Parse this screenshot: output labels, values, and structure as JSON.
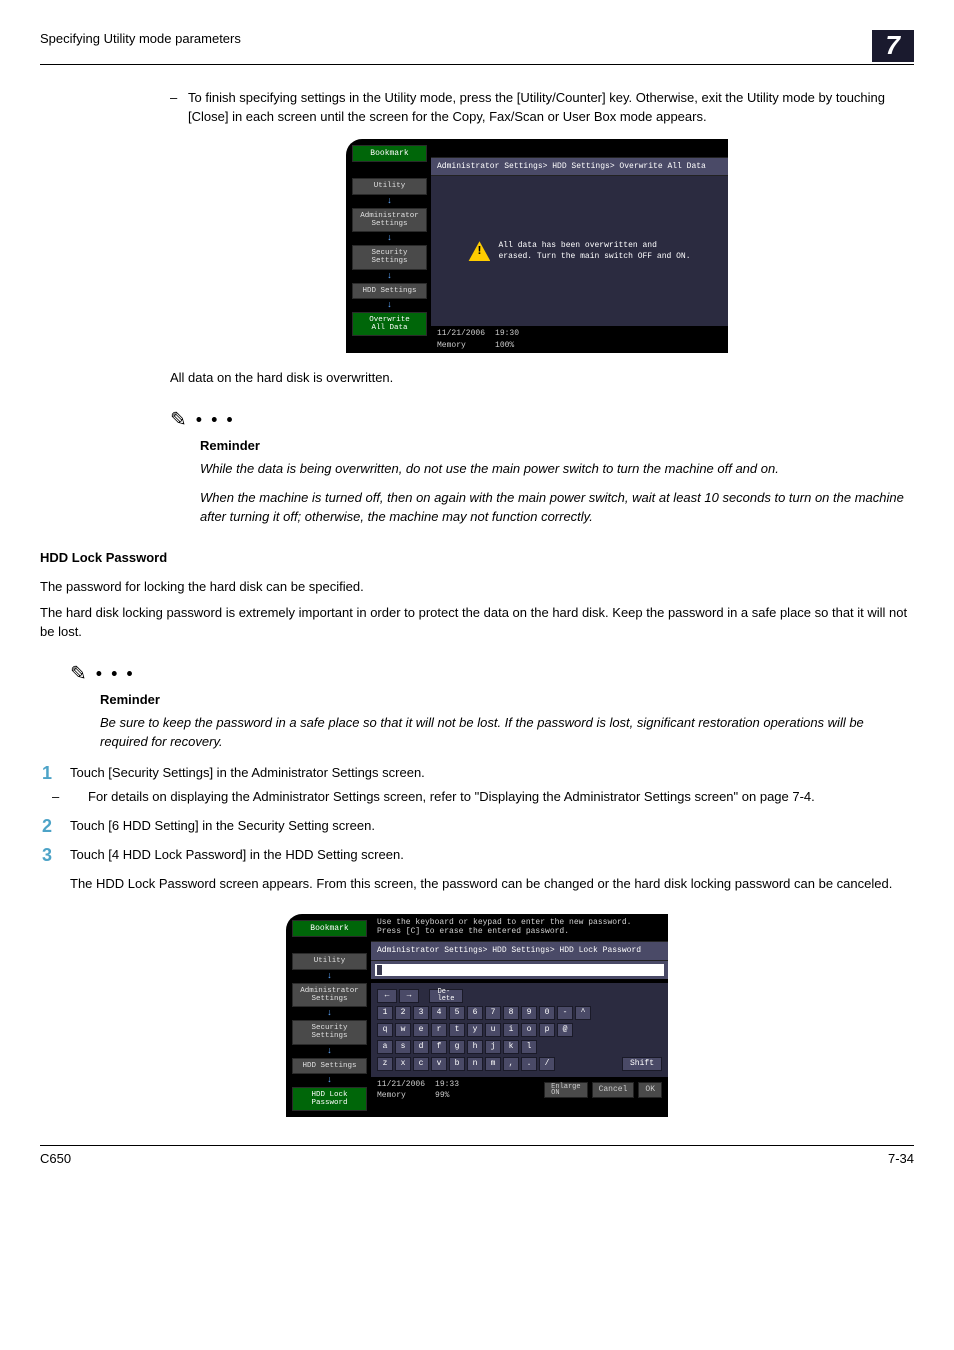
{
  "header": {
    "title": "Specifying Utility mode parameters",
    "chapter": "7"
  },
  "intro_bullet": "To finish specifying settings in the Utility mode, press the [Utility/Counter] key. Otherwise, exit the Utility mode by touching [Close] in each screen until the screen for the Copy, Fax/Scan or User Box mode appears.",
  "shot1": {
    "bookmark": "Bookmark",
    "steps": [
      "Utility",
      "Administrator\nSettings",
      "Security\nSettings",
      "HDD Settings",
      "Overwrite\nAll Data"
    ],
    "crumb": "Administrator Settings> HDD Settings> Overwrite All Data",
    "msg": "All data has been overwritten and\nerased. Turn the main switch OFF and ON.",
    "date": "11/21/2006",
    "time": "19:30",
    "mem_label": "Memory",
    "mem_val": "100%"
  },
  "after_shot1": "All data on the hard disk is overwritten.",
  "reminder1": {
    "title": "Reminder",
    "p1": "While the data is being overwritten, do not use the main power switch to turn the machine off and on.",
    "p2": "When the machine is turned off, then on again with the main power switch, wait at least 10 seconds to turn on the machine after turning it off; otherwise, the machine may not function correctly."
  },
  "section": {
    "heading": "HDD Lock Password",
    "p1": "The password for locking the hard disk can be specified.",
    "p2": "The hard disk locking password is extremely important in order to protect the data on the hard disk. Keep the password in a safe place so that it will not be lost."
  },
  "reminder2": {
    "title": "Reminder",
    "p1": "Be sure to keep the password in a safe place so that it will not be lost. If the password is lost, significant restoration operations will be required for recovery."
  },
  "steps": {
    "s1": "Touch [Security Settings] in the Administrator Settings screen.",
    "s1_sub": "For details on displaying the Administrator Settings screen, refer to \"Displaying the Administrator Settings screen\" on page 7-4.",
    "s2": "Touch [6 HDD Setting] in the Security Setting screen.",
    "s3": "Touch [4 HDD Lock Password] in the HDD Setting screen.",
    "s3_after": "The HDD Lock Password screen appears. From this screen, the password can be changed or the hard disk locking password can be canceled."
  },
  "shot2": {
    "bookmark": "Bookmark",
    "steps": [
      "Utility",
      "Administrator\nSettings",
      "Security\nSettings",
      "HDD Settings",
      "HDD Lock\nPassword"
    ],
    "instr": "Use the keyboard or keypad to enter the new password.\nPress [C] to erase the entered password.",
    "crumb": "Administrator Settings> HDD Settings> HDD Lock Password",
    "del_label": "De-\nlete",
    "row1": [
      "1",
      "2",
      "3",
      "4",
      "5",
      "6",
      "7",
      "8",
      "9",
      "0",
      "-",
      "^"
    ],
    "row2": [
      "q",
      "w",
      "e",
      "r",
      "t",
      "y",
      "u",
      "i",
      "o",
      "p",
      "@"
    ],
    "row3": [
      "a",
      "s",
      "d",
      "f",
      "g",
      "h",
      "j",
      "k",
      "l"
    ],
    "row4": [
      "z",
      "x",
      "c",
      "v",
      "b",
      "n",
      "m",
      ",",
      ".",
      "/"
    ],
    "shift": "Shift",
    "date": "11/21/2006",
    "time": "19:33",
    "mem_label": "Memory",
    "mem_val": "99%",
    "enlarge": "Enlarge\nON",
    "cancel": "Cancel",
    "ok": "OK"
  },
  "footer": {
    "left": "C650",
    "right": "7-34"
  }
}
